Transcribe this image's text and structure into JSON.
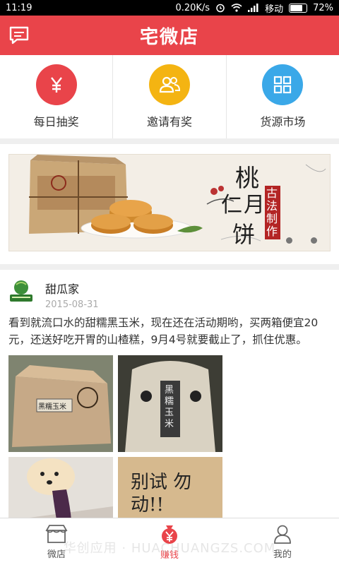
{
  "status": {
    "time": "11:19",
    "speed": "0.20K/s",
    "carrier": "移动",
    "battery": "72%"
  },
  "header": {
    "title": "宅微店"
  },
  "quick": [
    {
      "label": "每日抽奖",
      "icon": "yen-icon",
      "color": "#e9444a"
    },
    {
      "label": "邀请有奖",
      "icon": "users-icon",
      "color": "#f4b412"
    },
    {
      "label": "货源市场",
      "icon": "grid-icon",
      "color": "#3aa8e8"
    }
  ],
  "banner": {
    "title_chars": [
      "桃",
      "仁",
      "月",
      "饼"
    ],
    "stamp": "古法制作"
  },
  "post": {
    "name": "甜瓜家",
    "date": "2015-08-31",
    "text": "看到就流口水的甜糯黑玉米，现在还在活动期哟，买两箱便宜20元，还送好吃开胃的山楂糕，9月4号就要截止了，抓住优惠。",
    "photo1_label": "黑糯玉米",
    "photo2_label": "黑糯玉米",
    "photo4_label": "别试 勿动!!"
  },
  "nav": [
    {
      "label": "微店",
      "icon": "shop-icon",
      "active": false
    },
    {
      "label": "赚钱",
      "icon": "money-bag-icon",
      "active": true
    },
    {
      "label": "我的",
      "icon": "person-icon",
      "active": false
    }
  ],
  "watermark": "华创应用 · HUACHUANGZS.COM"
}
